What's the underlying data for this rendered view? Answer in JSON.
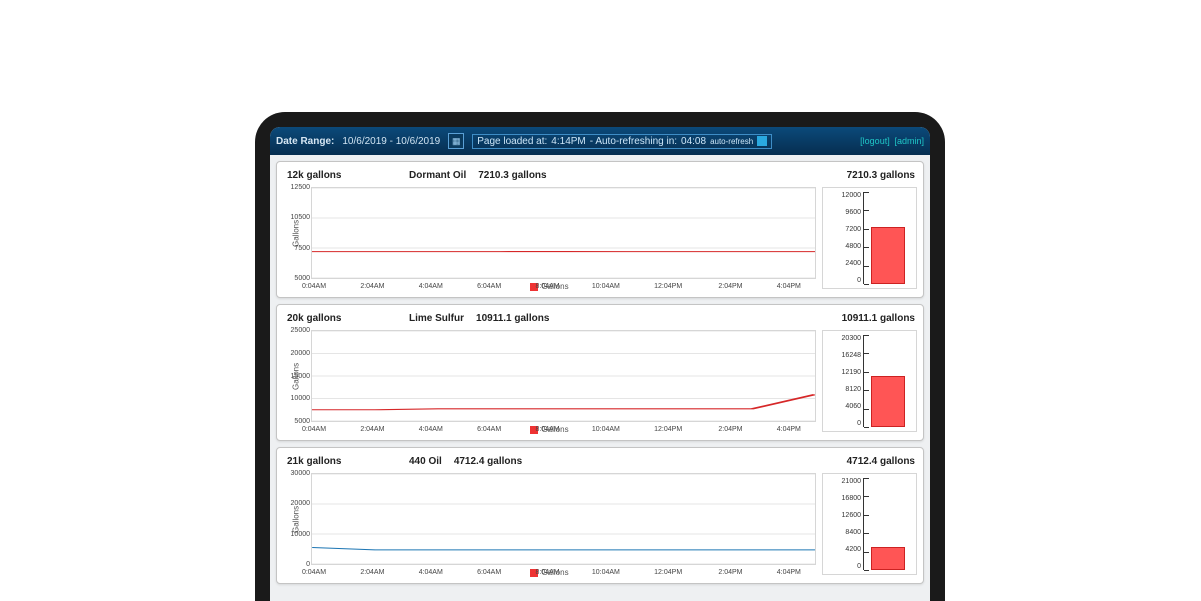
{
  "header": {
    "date_range_label": "Date Range:",
    "date_range_value": "10/6/2019 - 10/6/2019",
    "page_loaded_prefix": "Page loaded at: ",
    "page_loaded_time": "4:14PM",
    "auto_refresh_prefix": " - Auto-refreshing in: ",
    "auto_refresh_countdown": "04:08",
    "auto_refresh_label": "auto-refresh",
    "links": {
      "logout": "[logout]",
      "admin": "[admin]"
    }
  },
  "legend_label": "Gallons",
  "axis_label": "Gallons",
  "x_categories": [
    "0:04AM",
    "2:04AM",
    "4:04AM",
    "6:04AM",
    "8:04AM",
    "10:04AM",
    "12:04PM",
    "2:04PM",
    "4:04PM"
  ],
  "panels": [
    {
      "capacity_label": "12k gallons",
      "product_name": "Dormant Oil",
      "current_value_label": "7210.3 gallons",
      "gauge_label": "7210.3 gallons",
      "series_color": "red",
      "y_ticks": [
        "12500",
        "10500",
        "7500",
        "5000"
      ],
      "gauge_ticks": [
        "12000",
        "9600",
        "7200",
        "4800",
        "2400",
        "0"
      ],
      "gauge_max": 12000,
      "gauge_value": 7210.3,
      "line_values": [
        7200,
        7200,
        7200,
        7200,
        7205,
        7200,
        7200,
        7200,
        7200
      ]
    },
    {
      "capacity_label": "20k gallons",
      "product_name": "Lime Sulfur",
      "current_value_label": "10911.1 gallons",
      "gauge_label": "10911.1 gallons",
      "series_color": "red",
      "y_ticks": [
        "25000",
        "20000",
        "15000",
        "10000",
        "5000"
      ],
      "gauge_ticks": [
        "20300",
        "16248",
        "12190",
        "8120",
        "4060",
        "0"
      ],
      "gauge_max": 20300,
      "gauge_value": 10911.1,
      "line_values": [
        7500,
        7500,
        7700,
        7700,
        7700,
        7700,
        7700,
        7700,
        10900
      ]
    },
    {
      "capacity_label": "21k gallons",
      "product_name": "440 Oil",
      "current_value_label": "4712.4 gallons",
      "gauge_label": "4712.4 gallons",
      "series_color": "blue",
      "y_ticks": [
        "30000",
        "20000",
        "10000",
        "0"
      ],
      "gauge_ticks": [
        "21000",
        "16800",
        "12600",
        "8400",
        "4200",
        "0"
      ],
      "gauge_max": 21000,
      "gauge_value": 4712.4,
      "line_values": [
        5500,
        4700,
        4700,
        4700,
        4700,
        4700,
        4700,
        4700,
        4700
      ]
    }
  ],
  "chart_data": [
    {
      "type": "line",
      "title": "Dormant Oil",
      "ylabel": "Gallons",
      "x": [
        "0:04AM",
        "2:04AM",
        "4:04AM",
        "6:04AM",
        "8:04AM",
        "10:04AM",
        "12:04PM",
        "2:04PM",
        "4:04PM"
      ],
      "series": [
        {
          "name": "Gallons",
          "values": [
            7200,
            7200,
            7200,
            7200,
            7205,
            7200,
            7200,
            7200,
            7200
          ]
        }
      ],
      "ylim": [
        5000,
        12500
      ],
      "gauge": {
        "value": 7210.3,
        "max": 12000
      }
    },
    {
      "type": "line",
      "title": "Lime Sulfur",
      "ylabel": "Gallons",
      "x": [
        "0:04AM",
        "2:04AM",
        "4:04AM",
        "6:04AM",
        "8:04AM",
        "10:04AM",
        "12:04PM",
        "2:04PM",
        "4:04PM"
      ],
      "series": [
        {
          "name": "Gallons",
          "values": [
            7500,
            7500,
            7700,
            7700,
            7700,
            7700,
            7700,
            7700,
            10900
          ]
        }
      ],
      "ylim": [
        5000,
        25000
      ],
      "gauge": {
        "value": 10911.1,
        "max": 20300
      }
    },
    {
      "type": "line",
      "title": "440 Oil",
      "ylabel": "Gallons",
      "x": [
        "0:04AM",
        "2:04AM",
        "4:04AM",
        "6:04AM",
        "8:04AM",
        "10:04AM",
        "12:04PM",
        "2:04PM",
        "4:04PM"
      ],
      "series": [
        {
          "name": "Gallons",
          "values": [
            5500,
            4700,
            4700,
            4700,
            4700,
            4700,
            4700,
            4700,
            4700
          ]
        }
      ],
      "ylim": [
        0,
        30000
      ],
      "gauge": {
        "value": 4712.4,
        "max": 21000
      }
    }
  ]
}
